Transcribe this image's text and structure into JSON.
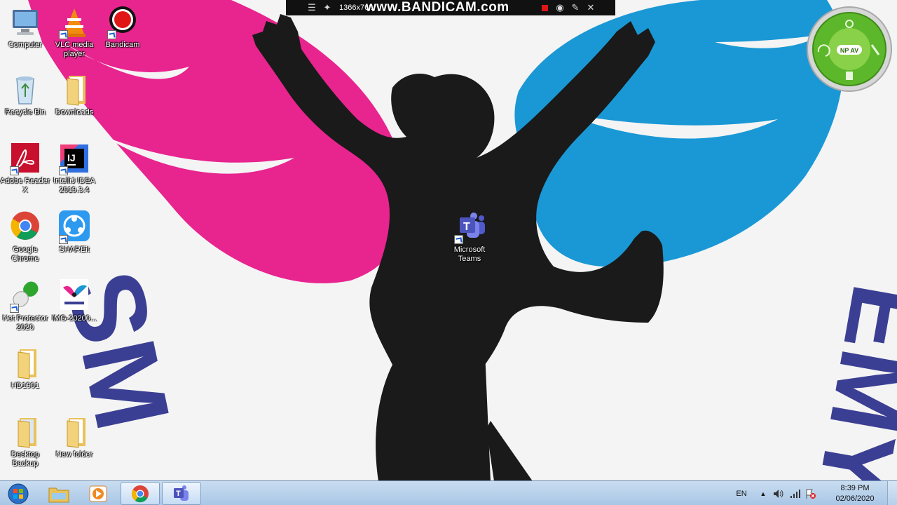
{
  "recorder": {
    "resolution": "1366x768",
    "brand": "www.BANDICAM.com"
  },
  "desktop_icons": [
    {
      "label": "Computer",
      "icon": "computer-icon"
    },
    {
      "label": "VLC media player",
      "icon": "vlc-icon"
    },
    {
      "label": "Bandicam",
      "icon": "bandicam-icon"
    },
    {
      "label": "Recycle Bin",
      "icon": "recycle-bin-icon"
    },
    {
      "label": "Downloads",
      "icon": "folder-icon"
    },
    {
      "label": "Adobe Reader X",
      "icon": "adobe-reader-icon"
    },
    {
      "label": "IntelliJ IDEA 2019.3.4",
      "icon": "intellij-icon"
    },
    {
      "label": "Google Chrome",
      "icon": "chrome-icon"
    },
    {
      "label": "SHAREit",
      "icon": "shareit-icon"
    },
    {
      "label": "Net Protector 2020",
      "icon": "net-protector-icon"
    },
    {
      "label": "IMG-20200...",
      "icon": "image-file-icon"
    },
    {
      "label": "HD1901",
      "icon": "folder-icon"
    },
    {
      "label": "Desktop Backup",
      "icon": "folder-icon"
    },
    {
      "label": "New folder",
      "icon": "folder-icon"
    },
    {
      "label": "Microsoft Teams",
      "icon": "teams-icon"
    }
  ],
  "wallpaper": {
    "text_left": "SM",
    "text_right": "EMY",
    "colors": {
      "pink": "#e8248f",
      "blue": "#1a98d5",
      "silhouette": "#1a1a1a",
      "text": "#3b3f93"
    }
  },
  "gadget": {
    "badge": "NP AV"
  },
  "taskbar": {
    "pinned": [
      {
        "icon": "explorer-folder-icon"
      },
      {
        "icon": "media-player-icon"
      },
      {
        "icon": "chrome-icon"
      },
      {
        "icon": "teams-icon"
      }
    ],
    "tray": {
      "language": "EN",
      "time": "8:39 PM",
      "date": "02/06/2020"
    }
  }
}
